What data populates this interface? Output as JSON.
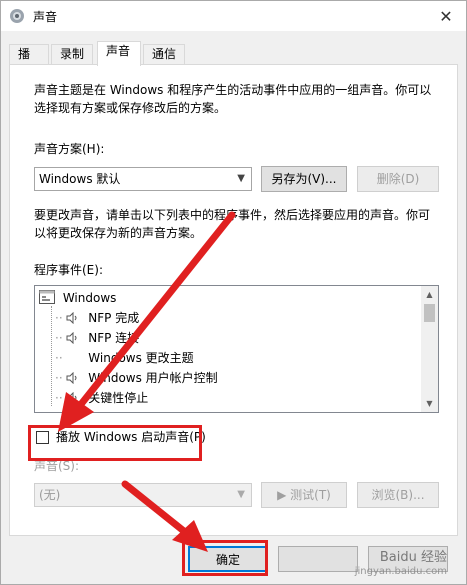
{
  "window": {
    "title": "声音",
    "close_glyph": "✕"
  },
  "tabs": [
    {
      "label": "播放",
      "active": false
    },
    {
      "label": "录制",
      "active": false
    },
    {
      "label": "声音",
      "active": true
    },
    {
      "label": "通信",
      "active": false
    }
  ],
  "sounds": {
    "intro_line1": "声音主题是在 Windows 和程序产生的活动事件中应用的一组声音。你可以",
    "intro_line2": "选择现有方案或保存修改后的方案。",
    "scheme_label": "声音方案(H):",
    "scheme_value": "Windows 默认",
    "save_as_label": "另存为(V)...",
    "delete_label": "删除(D)",
    "change_line1": "要更改声音，请单击以下列表中的程序事件，然后选择要应用的声音。你可",
    "change_line2": "以将更改保存为新的声音方案。",
    "events_label": "程序事件(E):",
    "events": [
      {
        "label": "Windows",
        "level": 0,
        "icon": "windows-folder-icon"
      },
      {
        "label": "NFP 完成",
        "level": 1,
        "icon": "speaker-icon"
      },
      {
        "label": "NFP 连接",
        "level": 1,
        "icon": "speaker-icon"
      },
      {
        "label": "Windows 更改主题",
        "level": 1,
        "icon": ""
      },
      {
        "label": "Windows 用户帐户控制",
        "level": 1,
        "icon": "speaker-icon"
      },
      {
        "label": "关键性停止",
        "level": 1,
        "icon": "speaker-icon"
      }
    ],
    "startup_sound_label": "播放 Windows 启动声音(P)",
    "startup_sound_checked": false,
    "sound_label": "声音(S):",
    "sound_value": "(无)",
    "test_label": "▶ 测试(T)",
    "browse_label": "浏览(B)..."
  },
  "footer": {
    "ok_label": "确定"
  },
  "watermark": {
    "line1": "Baidu 经验",
    "line2": "jingyan.baidu.com"
  },
  "colors": {
    "annotation_red": "#e02020",
    "accent": "#0078d7"
  }
}
